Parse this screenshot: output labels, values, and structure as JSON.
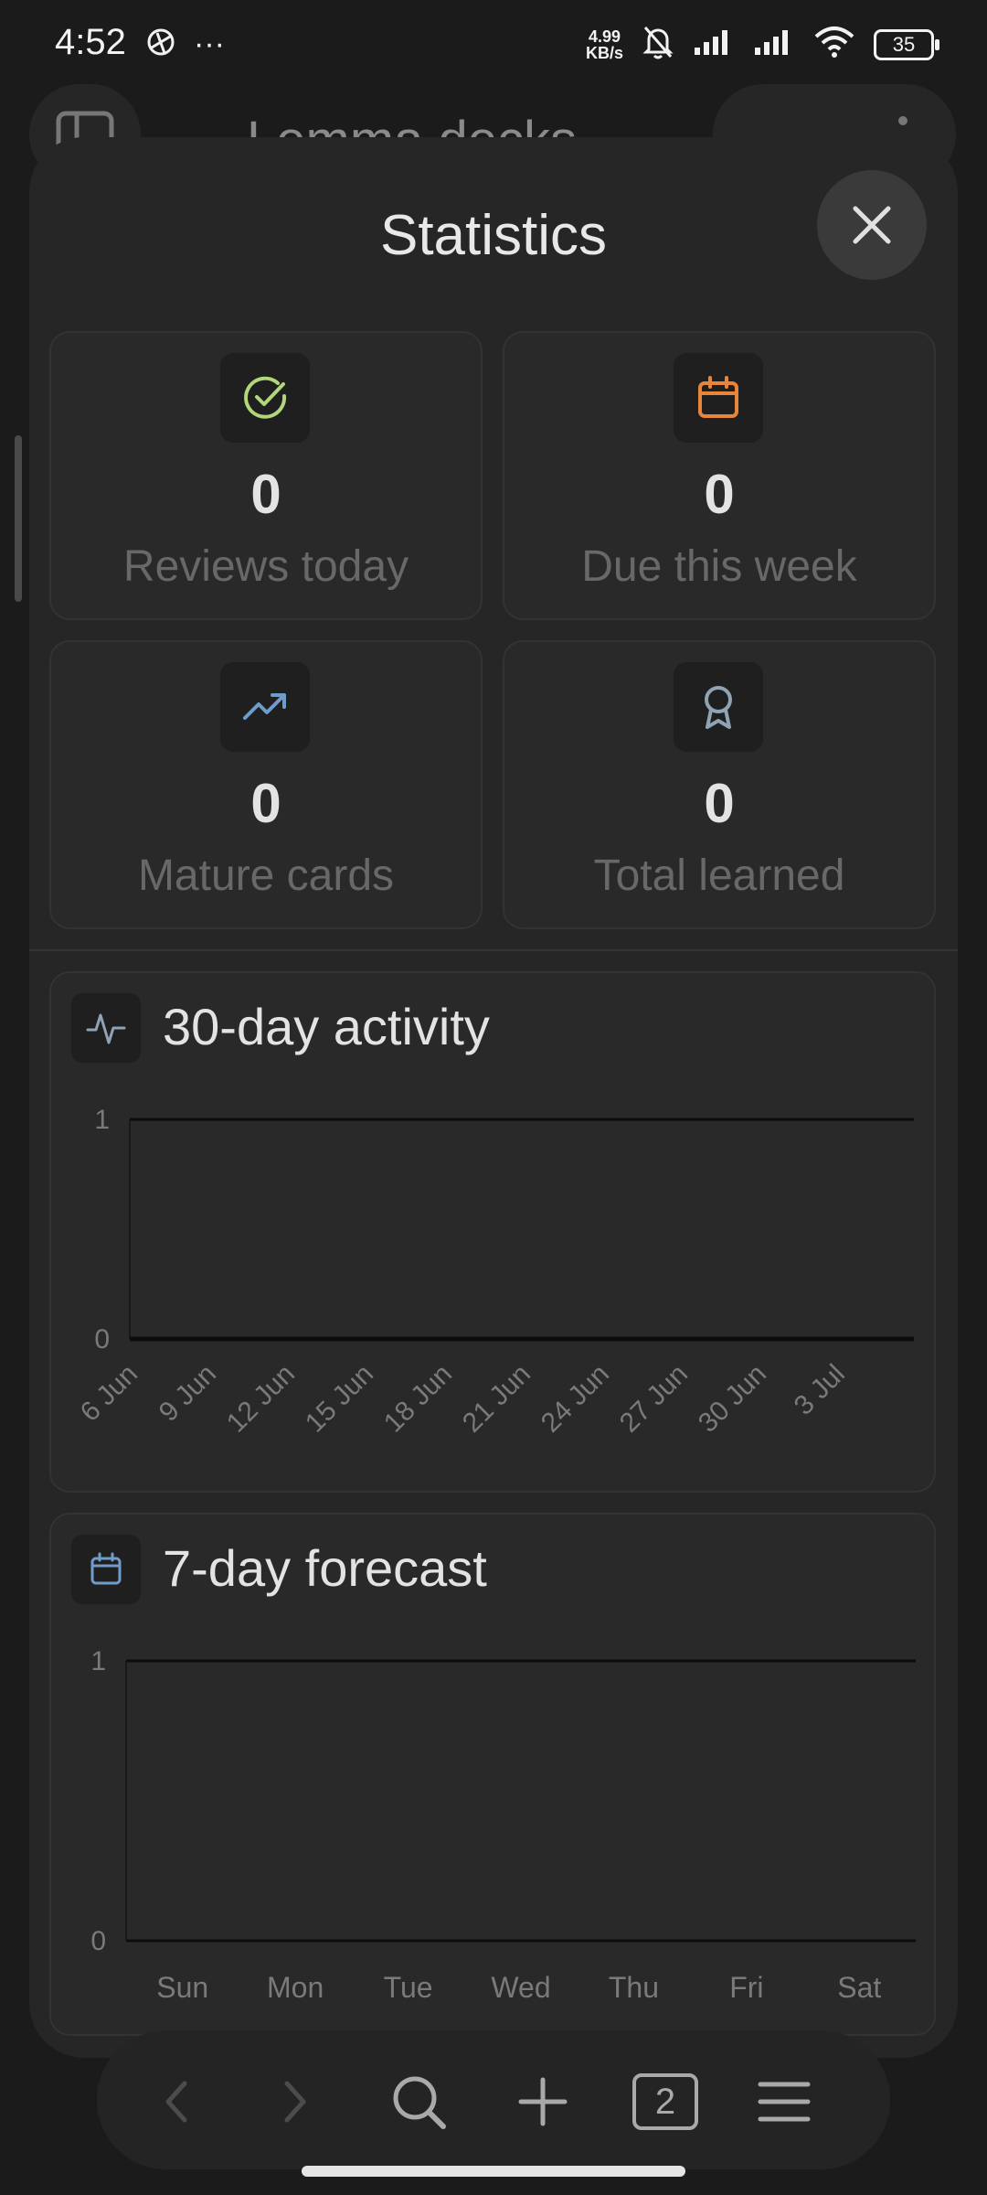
{
  "status_bar": {
    "time": "4:52",
    "overflow": "···",
    "net_speed_value": "4.99",
    "net_speed_unit": "KB/s",
    "battery": "35"
  },
  "app_header": {
    "title": "Lemma decks"
  },
  "sheet": {
    "title": "Statistics",
    "stats": [
      {
        "icon": "check-circle-icon",
        "color": "#b3d67a",
        "value": "0",
        "label": "Reviews today"
      },
      {
        "icon": "calendar-icon",
        "color": "#e8853a",
        "value": "0",
        "label": "Due this week"
      },
      {
        "icon": "trending-up-icon",
        "color": "#6f9cc9",
        "value": "0",
        "label": "Mature cards"
      },
      {
        "icon": "award-icon",
        "color": "#8fa3b5",
        "value": "0",
        "label": "Total learned"
      }
    ]
  },
  "activity_card": {
    "title": "30-day activity",
    "icon": "activity-icon"
  },
  "forecast_card": {
    "title": "7-day forecast",
    "icon": "calendar-icon"
  },
  "chart_data": [
    {
      "type": "line",
      "title": "30-day activity",
      "x": [
        "6 Jun",
        "9 Jun",
        "12 Jun",
        "15 Jun",
        "18 Jun",
        "21 Jun",
        "24 Jun",
        "27 Jun",
        "30 Jun",
        "3 Jul"
      ],
      "series": [
        {
          "values": [
            0,
            0,
            0,
            0,
            0,
            0,
            0,
            0,
            0,
            0
          ]
        }
      ],
      "yticks": [
        "0",
        "1"
      ],
      "ylim": [
        0,
        1
      ],
      "grid": true
    },
    {
      "type": "bar",
      "title": "7-day forecast",
      "categories": [
        "Sun",
        "Mon",
        "Tue",
        "Wed",
        "Thu",
        "Fri",
        "Sat"
      ],
      "values": [
        0,
        0,
        0,
        0,
        0,
        0,
        0
      ],
      "yticks": [
        "0",
        "1"
      ],
      "ylim": [
        0,
        1
      ],
      "grid": true
    }
  ],
  "bottom_nav": {
    "tab_count": "2"
  }
}
